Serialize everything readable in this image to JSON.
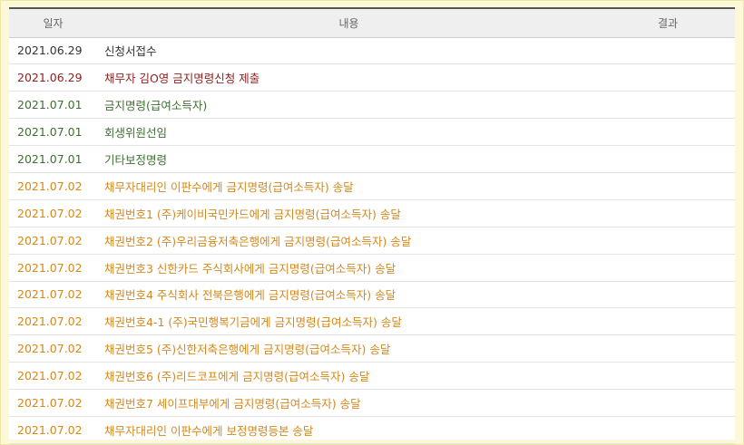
{
  "table": {
    "headers": {
      "date": "일자",
      "content": "내용",
      "result": "결과"
    },
    "rows": [
      {
        "date": "2021.06.29",
        "content": "신청서접수",
        "result": ""
      },
      {
        "date": "2021.06.29",
        "content": "채무자 김O영 금지명령신청 제출",
        "result": ""
      },
      {
        "date": "2021.07.01",
        "content": "금지명령(급여소득자)",
        "result": ""
      },
      {
        "date": "2021.07.01",
        "content": "회생위원선임",
        "result": ""
      },
      {
        "date": "2021.07.01",
        "content": "기타보정명령",
        "result": ""
      },
      {
        "date": "2021.07.02",
        "content": "채무자대리인 이판수에게 금지명령(급여소득자) 송달",
        "result": ""
      },
      {
        "date": "2021.07.02",
        "content": "채권번호1 (주)케이비국민카드에게 금지명령(급여소득자) 송달",
        "result": ""
      },
      {
        "date": "2021.07.02",
        "content": "채권번호2 (주)우리금융저축은행에게 금지명령(급여소득자) 송달",
        "result": ""
      },
      {
        "date": "2021.07.02",
        "content": "채권번호3 신한카드 주식회사에게 금지명령(급여소득자) 송달",
        "result": ""
      },
      {
        "date": "2021.07.02",
        "content": "채권번호4 주식회사 전북은행에게 금지명령(급여소득자) 송달",
        "result": ""
      },
      {
        "date": "2021.07.02",
        "content": "채권번호4-1 (주)국민행복기금에게 금지명령(급여소득자) 송달",
        "result": ""
      },
      {
        "date": "2021.07.02",
        "content": "채권번호5 (주)신한저축은행에게 금지명령(급여소득자) 송달",
        "result": ""
      },
      {
        "date": "2021.07.02",
        "content": "채권번호6 (주)리드코프에게 금지명령(급여소득자) 송달",
        "result": ""
      },
      {
        "date": "2021.07.02",
        "content": "채권번호7 세이프대부에게 금지명령(급여소득자) 송달",
        "result": ""
      },
      {
        "date": "2021.07.02",
        "content": "채무자대리인 이판수에게 보정명령등본 송달",
        "result": ""
      }
    ]
  },
  "colors": {
    "black": "#333333",
    "red": "#8b2222",
    "green": "#3f6e32",
    "orange": "#d4881c"
  }
}
